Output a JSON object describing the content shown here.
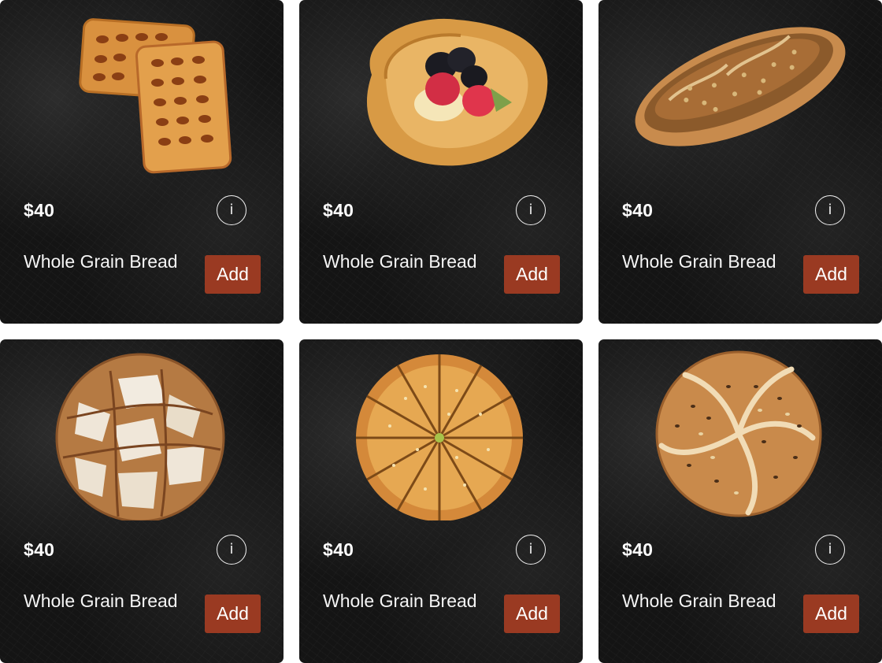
{
  "products": [
    {
      "price": "$40",
      "name": "Whole Grain Bread",
      "info_label": "i",
      "add_label": "Add",
      "image": "lattice-danish-pastry"
    },
    {
      "price": "$40",
      "name": "Whole Grain Bread",
      "info_label": "i",
      "add_label": "Add",
      "image": "berry-danish-pastry"
    },
    {
      "price": "$40",
      "name": "Whole Grain Bread",
      "info_label": "i",
      "add_label": "Add",
      "image": "seeded-baguette"
    },
    {
      "price": "$40",
      "name": "Whole Grain Bread",
      "info_label": "i",
      "add_label": "Add",
      "image": "rustic-sourdough-loaf"
    },
    {
      "price": "$40",
      "name": "Whole Grain Bread",
      "info_label": "i",
      "add_label": "Add",
      "image": "sliced-round-pie"
    },
    {
      "price": "$40",
      "name": "Whole Grain Bread",
      "info_label": "i",
      "add_label": "Add",
      "image": "seeded-kaiser-roll"
    }
  ],
  "colors": {
    "card_background": "#141414",
    "add_button": "#9a3a22",
    "text": "#ffffff"
  }
}
